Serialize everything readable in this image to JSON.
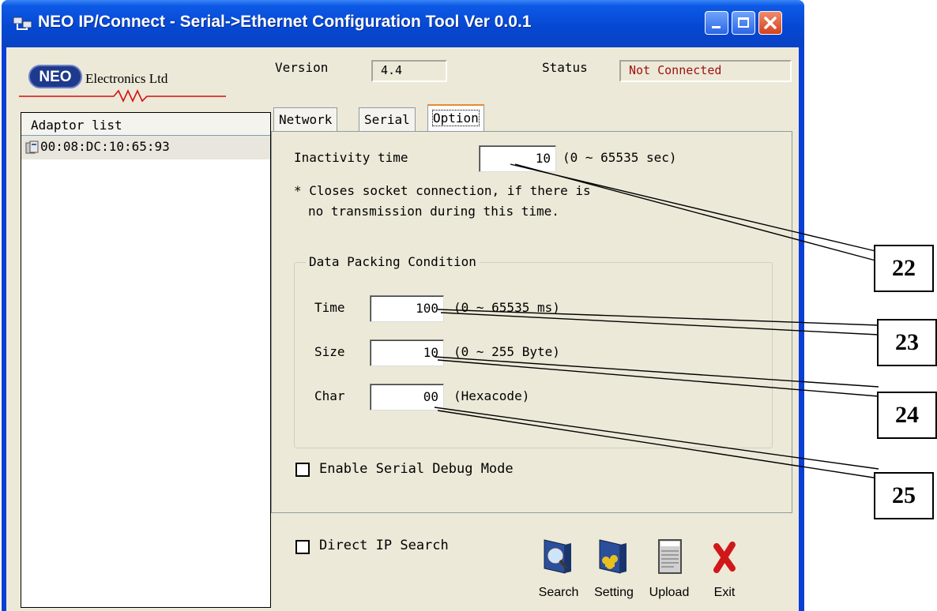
{
  "window": {
    "title": "NEO IP/Connect - Serial->Ethernet Configuration Tool Ver 0.0.1",
    "buttons": [
      "minimize",
      "maximize",
      "close"
    ]
  },
  "logo": {
    "badge": "NEO",
    "company": "Electronics Ltd"
  },
  "header": {
    "version_label": "Version",
    "version_value": "4.4",
    "status_label": "Status",
    "status_value": "Not Connected",
    "status_color": "#a01010"
  },
  "adaptor_list": {
    "title": "Adaptor list",
    "items": [
      {
        "mac": "00:08:DC:10:65:93",
        "icon": "network-device-icon"
      }
    ]
  },
  "tabs": [
    {
      "label": "Network",
      "active": false
    },
    {
      "label": "Serial",
      "active": false
    },
    {
      "label": "Option",
      "active": true
    }
  ],
  "option": {
    "inactivity_label": "Inactivity time",
    "inactivity_value": "10",
    "inactivity_range": "(0 ~ 65535 sec)",
    "note_line1": "* Closes socket connection, if there is",
    "note_line2": "no transmission during this time.",
    "packing": {
      "title": "Data Packing Condition",
      "time_label": "Time",
      "time_value": "100",
      "time_range": "(0 ~ 65535 ms)",
      "size_label": "Size",
      "size_value": "10",
      "size_range": "(0 ~ 255 Byte)",
      "char_label": "Char",
      "char_value": "00",
      "char_range": "(Hexacode)"
    },
    "debug_label": "Enable Serial Debug Mode",
    "debug_checked": false
  },
  "bottom": {
    "direct_ip_label": "Direct IP Search",
    "direct_ip_checked": false,
    "buttons": [
      {
        "label": "Search",
        "icon": "search-icon"
      },
      {
        "label": "Setting",
        "icon": "setting-icon"
      },
      {
        "label": "Upload",
        "icon": "upload-icon"
      },
      {
        "label": "Exit",
        "icon": "exit-icon"
      }
    ]
  },
  "callouts": [
    "22",
    "23",
    "24",
    "25"
  ]
}
